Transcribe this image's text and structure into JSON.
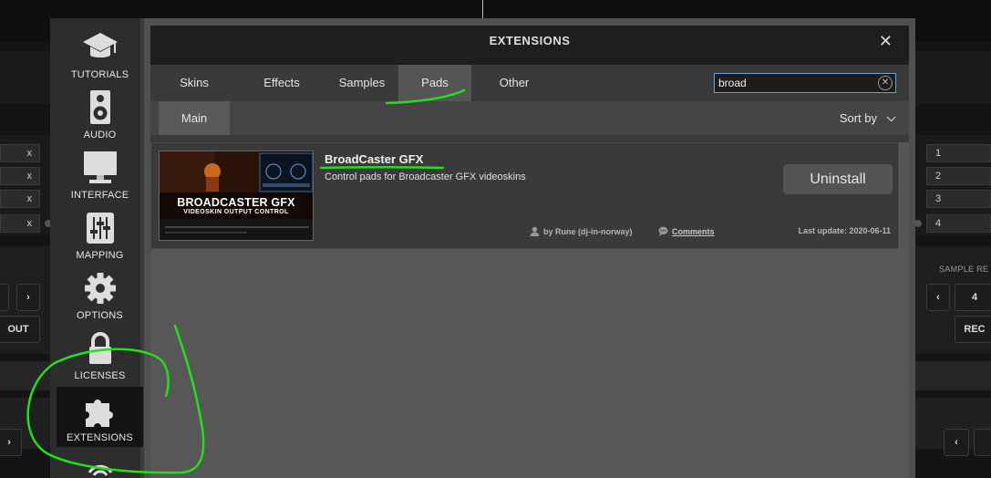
{
  "background": {
    "delete_mark": "x",
    "pad_numbers": [
      "1",
      "2",
      "3",
      "4"
    ],
    "out_button": "OUT",
    "rec_button": "REC",
    "sample_label": "SAMPLE RE",
    "sample_value": "4"
  },
  "sidebar": {
    "items": [
      {
        "label": "TUTORIALS",
        "icon": "graduation-cap-icon"
      },
      {
        "label": "AUDIO",
        "icon": "speaker-icon"
      },
      {
        "label": "INTERFACE",
        "icon": "monitor-icon"
      },
      {
        "label": "MAPPING",
        "icon": "sliders-icon"
      },
      {
        "label": "OPTIONS",
        "icon": "gear-icon"
      },
      {
        "label": "LICENSES",
        "icon": "lock-icon"
      },
      {
        "label": "EXTENSIONS",
        "icon": "puzzle-icon",
        "active": true
      }
    ]
  },
  "dialog": {
    "title": "EXTENSIONS",
    "close": "✕",
    "tabs": [
      "Skins",
      "Effects",
      "Samples",
      "Pads",
      "Other"
    ],
    "active_tab": "Pads",
    "search": {
      "value": "broad",
      "clear": "✕"
    },
    "subtab": "Main",
    "sort_label": "Sort by"
  },
  "results": [
    {
      "name": "BroadCaster GFX",
      "description": "Control pads for Broadcaster GFX videoskins",
      "thumb_title": "BROADCASTER GFX",
      "thumb_subtitle": "VIDEOSKIN OUTPUT CONTROL",
      "action": "Uninstall",
      "author": "by Rune (dj-in-norway)",
      "comments": "Comments",
      "last_update": "Last update: 2020-06-11"
    }
  ],
  "colors": {
    "annotation": "#22e01a",
    "panel": "#505050",
    "active_sidebar": "#141414"
  }
}
